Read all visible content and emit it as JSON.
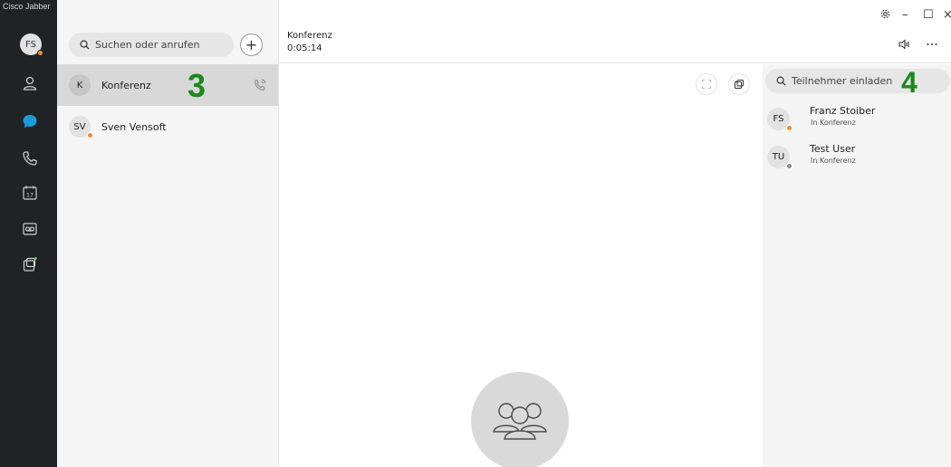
{
  "window": {
    "title": "Cisco Jabber",
    "controls": {
      "minimize": "–",
      "maximize": "☐",
      "close": "×"
    }
  },
  "user": {
    "initials": "FS",
    "presence_color": "#f28c28"
  },
  "rail_icons": [
    "contacts-icon",
    "chat-icon",
    "phone-icon",
    "calendar-icon",
    "voicemail-icon",
    "meetings-icon"
  ],
  "search": {
    "placeholder": "Suchen oder anrufen"
  },
  "list": {
    "items": [
      {
        "initials": "K",
        "label": "Konferenz"
      },
      {
        "initials": "SV",
        "label": "Sven Vensoft"
      }
    ]
  },
  "annotations": {
    "marker_list": "3",
    "marker_participants": "4"
  },
  "call": {
    "title": "Konferenz",
    "timer": "0:05:14"
  },
  "participants": {
    "invite_placeholder": "Teilnehmer einladen",
    "items": [
      {
        "initials": "FS",
        "name": "Franz Stoiber",
        "status": "In Konferenz",
        "presence_color": "#f28c28"
      },
      {
        "initials": "TU",
        "name": "Test User",
        "status": "In Konferenz",
        "presence_color": "#8a8a8a"
      }
    ]
  },
  "colors": {
    "rail": "#1f2326",
    "accent": "#1a9bd7",
    "marker": "#1a8a1a"
  }
}
